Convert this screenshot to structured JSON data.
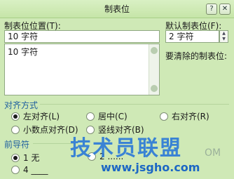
{
  "window": {
    "title": "制表位",
    "help_label": "?",
    "close_label": "✕"
  },
  "tab_position": {
    "label": "制表位位置(T):",
    "value": "10 字符",
    "list_items": [
      "10 字符"
    ]
  },
  "default_tab": {
    "label": "默认制表位(F):",
    "value": "2 字符"
  },
  "clear_tabs": {
    "label": "要清除的制表位:"
  },
  "alignment": {
    "title": "对齐方式",
    "options": [
      {
        "label": "左对齐(L)",
        "selected": true
      },
      {
        "label": "居中(C)",
        "selected": false
      },
      {
        "label": "右对齐(R)",
        "selected": false
      },
      {
        "label": "小数点对齐(D)",
        "selected": false
      },
      {
        "label": "竖线对齐(B)",
        "selected": false
      }
    ]
  },
  "leader": {
    "title": "前导符",
    "options": [
      {
        "label": "1 无",
        "selected": true
      },
      {
        "label": "2 ......",
        "selected": false
      },
      {
        "label": "4 ____",
        "selected": false
      }
    ]
  },
  "watermark": {
    "main": "技术员联盟",
    "url": "www.jsgho.com",
    "ghost": "OM"
  }
}
